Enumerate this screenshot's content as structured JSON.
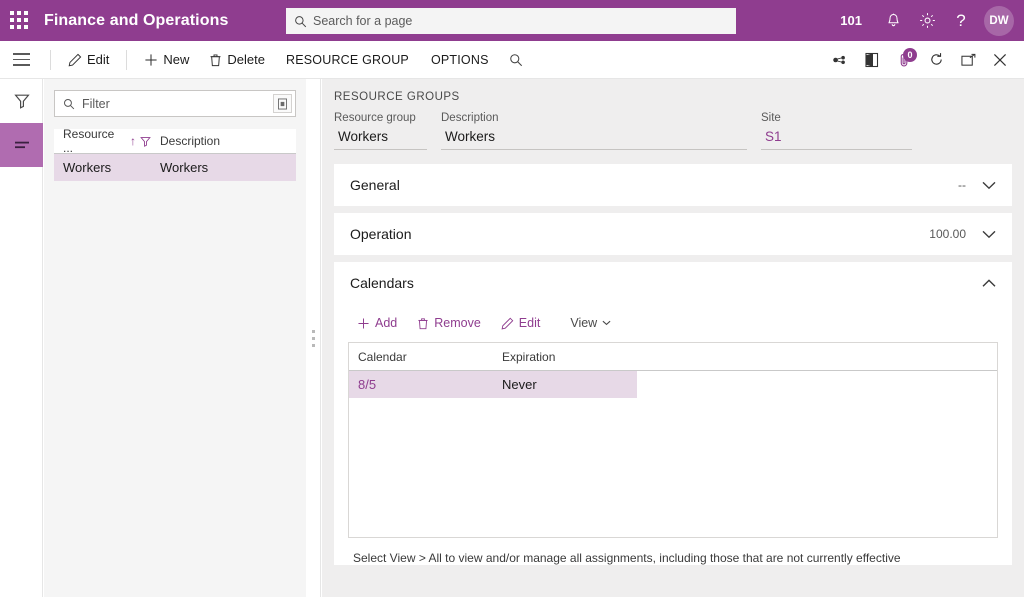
{
  "topbar": {
    "app_launcher_icon": "waffle-grid-icon",
    "title": "Finance and Operations",
    "search": {
      "icon": "search-icon",
      "placeholder": "Search for a page",
      "value": ""
    },
    "company": "101",
    "notifications_icon": "bell-icon",
    "settings_icon": "gear-icon",
    "help_icon": "question-mark-icon",
    "avatar_initials": "DW"
  },
  "commandbar": {
    "menu_icon": "hamburger-menu-icon",
    "buttons": [
      {
        "label": "Edit",
        "icon": "pencil-icon"
      },
      {
        "label": "New",
        "icon": "plus-icon"
      },
      {
        "label": "Delete",
        "icon": "trash-icon"
      }
    ],
    "tabs": [
      {
        "label": "RESOURCE GROUP"
      },
      {
        "label": "OPTIONS"
      }
    ],
    "search_icon": "search-icon",
    "right_icons": [
      {
        "name": "share-icon"
      },
      {
        "name": "office-app-icon"
      },
      {
        "name": "attachments-icon",
        "badge": "0"
      },
      {
        "name": "refresh-icon"
      },
      {
        "name": "popout-window-icon"
      },
      {
        "name": "close-icon"
      }
    ]
  },
  "rail": {
    "items": [
      {
        "icon": "filter-funnel-icon",
        "active": false
      },
      {
        "icon": "list-lines-icon",
        "active": true
      }
    ]
  },
  "listpane": {
    "filter": {
      "icon": "search-icon",
      "placeholder": "Filter",
      "value": "",
      "button_icon": "save-filter-icon"
    },
    "columns": [
      {
        "label": "Resource ...",
        "sort_icon": "sort-ascending-arrow",
        "filter_icon": "filter-funnel-icon"
      },
      {
        "label": "Description"
      }
    ],
    "rows": [
      {
        "resource": "Workers",
        "description": "Workers",
        "selected": true
      }
    ]
  },
  "splitter": {
    "icon": "splitter-grip-icon"
  },
  "content": {
    "caption": "RESOURCE GROUPS",
    "header_fields": [
      {
        "label": "Resource group",
        "value": "Workers",
        "is_link": false
      },
      {
        "label": "Description",
        "value": "Workers",
        "is_link": false
      },
      {
        "label": "Site",
        "value": "S1",
        "is_link": true
      }
    ],
    "fasttabs": [
      {
        "title": "General",
        "summary": "--",
        "expanded": false,
        "chevron": "chevron-down-icon"
      },
      {
        "title": "Operation",
        "summary": "100.00",
        "expanded": false,
        "chevron": "chevron-down-icon"
      },
      {
        "title": "Calendars",
        "summary": "",
        "expanded": true,
        "chevron": "chevron-up-icon"
      }
    ],
    "calendars": {
      "toolbar": [
        {
          "label": "Add",
          "icon": "plus-icon"
        },
        {
          "label": "Remove",
          "icon": "trash-icon"
        },
        {
          "label": "Edit",
          "icon": "pencil-icon"
        },
        {
          "label": "View",
          "icon": "chevron-down-icon"
        }
      ],
      "columns": [
        {
          "label": "Calendar"
        },
        {
          "label": "Expiration"
        }
      ],
      "rows": [
        {
          "calendar": "8/5",
          "expiration": "Never",
          "selected": true
        }
      ],
      "footer": "Select View > All to view and/or manage all assignments, including those that are not currently effective"
    }
  },
  "colors": {
    "brand_purple": "#8f3d8f",
    "rail_active": "#b06cb0",
    "row_selected": "#e7d9e7",
    "content_bg": "#efeeee",
    "link": "#8f3d8f"
  }
}
